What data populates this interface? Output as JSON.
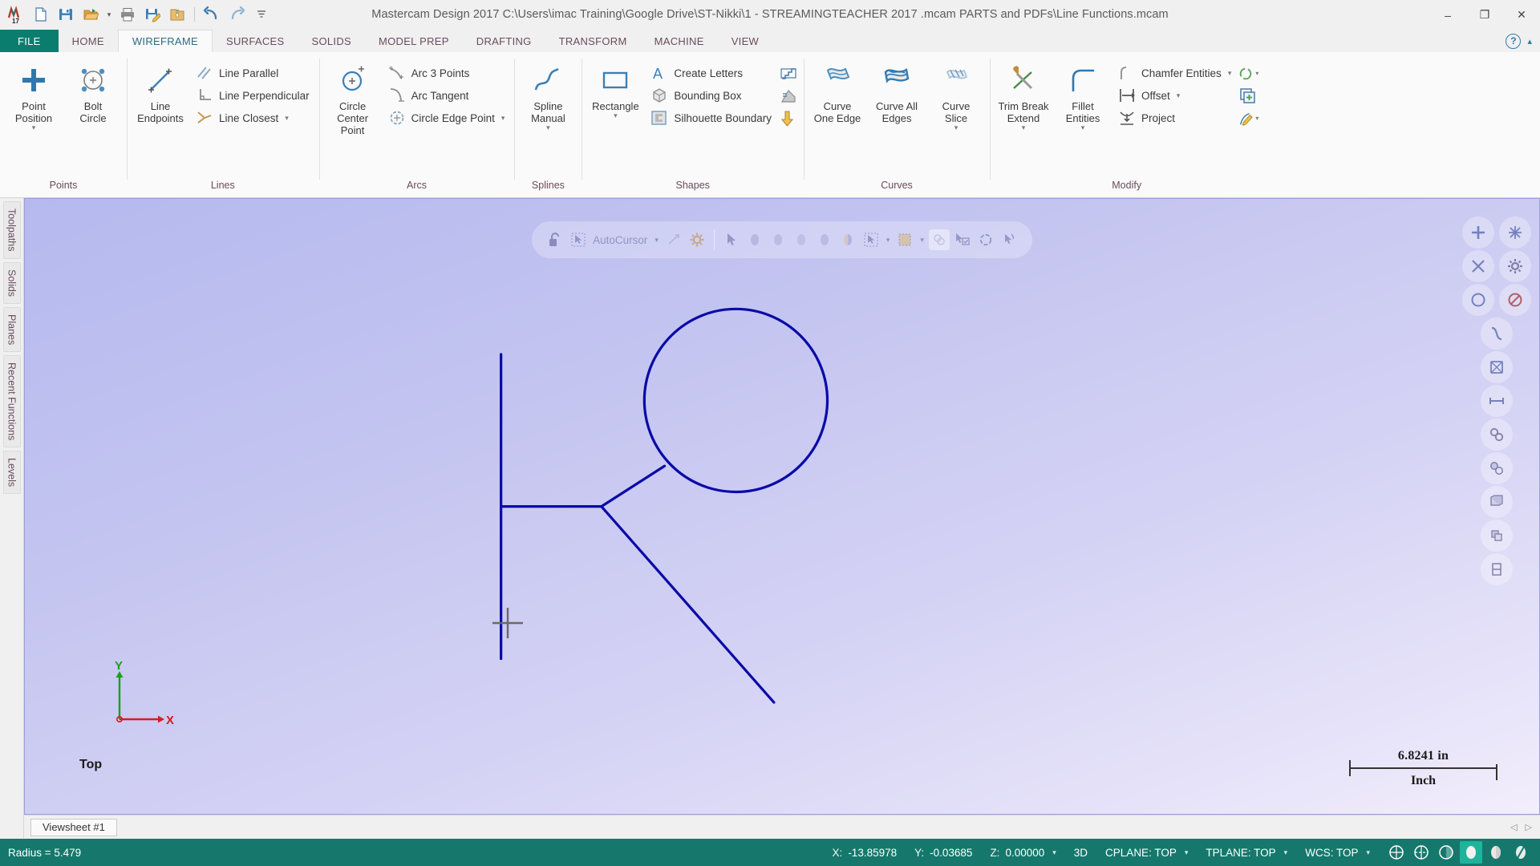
{
  "window": {
    "title": "Mastercam Design 2017  C:\\Users\\imac Training\\Google Drive\\ST-Nikki\\1 - STREAMINGTEACHER 2017 .mcam PARTS and PDFs\\Line Functions.mcam",
    "minimize": "–",
    "restore": "❐",
    "close": "✕"
  },
  "quick_access": [
    {
      "name": "mastercam-logo-icon",
      "label": "M17"
    },
    {
      "name": "new-file-icon",
      "label": "New"
    },
    {
      "name": "save-icon",
      "label": "Save"
    },
    {
      "name": "open-folder-icon",
      "label": "Open"
    },
    {
      "name": "open-dropdown-caret",
      "label": "▾"
    },
    {
      "name": "print-icon",
      "label": "Print"
    },
    {
      "name": "save-as-icon",
      "label": "Save As"
    },
    {
      "name": "zip2go-icon",
      "label": "Zip2Go"
    },
    {
      "name": "undo-icon",
      "label": "Undo"
    },
    {
      "name": "redo-icon",
      "label": "Redo"
    },
    {
      "name": "customize-qat-icon",
      "label": "≡"
    }
  ],
  "tabs": [
    {
      "label": "FILE",
      "kind": "file"
    },
    {
      "label": "HOME",
      "kind": "normal"
    },
    {
      "label": "WIREFRAME",
      "kind": "active"
    },
    {
      "label": "SURFACES",
      "kind": "normal"
    },
    {
      "label": "SOLIDS",
      "kind": "normal"
    },
    {
      "label": "MODEL PREP",
      "kind": "normal"
    },
    {
      "label": "DRAFTING",
      "kind": "normal"
    },
    {
      "label": "TRANSFORM",
      "kind": "normal"
    },
    {
      "label": "MACHINE",
      "kind": "normal"
    },
    {
      "label": "VIEW",
      "kind": "normal"
    }
  ],
  "help": {
    "help_label": "?",
    "collapse_label": "▴"
  },
  "ribbon": {
    "groups": [
      {
        "label": "Points",
        "big": [
          {
            "label": "Point\nPosition",
            "icon": "point-position-icon",
            "dropdown": true
          },
          {
            "label": "Bolt\nCircle",
            "icon": "bolt-circle-icon",
            "dropdown": false
          }
        ],
        "small": []
      },
      {
        "label": "Lines",
        "big": [
          {
            "label": "Line\nEndpoints",
            "icon": "line-endpoints-icon",
            "dropdown": false
          }
        ],
        "small": [
          {
            "label": "Line Parallel",
            "icon": "line-parallel-icon",
            "dropdown": false
          },
          {
            "label": "Line Perpendicular",
            "icon": "line-perpendicular-icon",
            "dropdown": false
          },
          {
            "label": "Line Closest",
            "icon": "line-closest-icon",
            "dropdown": true
          }
        ]
      },
      {
        "label": "Arcs",
        "big": [
          {
            "label": "Circle\nCenter Point",
            "icon": "circle-center-point-icon",
            "dropdown": false
          }
        ],
        "small": [
          {
            "label": "Arc 3 Points",
            "icon": "arc-3-points-icon",
            "dropdown": false
          },
          {
            "label": "Arc Tangent",
            "icon": "arc-tangent-icon",
            "dropdown": false
          },
          {
            "label": "Circle Edge Point",
            "icon": "circle-edge-point-icon",
            "dropdown": true
          }
        ]
      },
      {
        "label": "Splines",
        "big": [
          {
            "label": "Spline\nManual",
            "icon": "spline-manual-icon",
            "dropdown": true
          }
        ],
        "small": []
      },
      {
        "label": "Shapes",
        "big": [
          {
            "label": "Rectangle",
            "icon": "rectangle-icon",
            "dropdown": true
          }
        ],
        "small": [
          {
            "label": "Create Letters",
            "icon": "create-letters-icon",
            "dropdown": false
          },
          {
            "label": "Bounding Box",
            "icon": "bounding-box-icon",
            "dropdown": false
          },
          {
            "label": "Silhouette Boundary",
            "icon": "silhouette-boundary-icon",
            "dropdown": false
          }
        ],
        "icons": [
          {
            "name": "stairs-icon"
          },
          {
            "name": "relief-groove-icon"
          },
          {
            "name": "door-icon"
          }
        ]
      },
      {
        "label": "Curves",
        "big": [
          {
            "label": "Curve\nOne Edge",
            "icon": "curve-one-edge-icon",
            "dropdown": false
          },
          {
            "label": "Curve All\nEdges",
            "icon": "curve-all-edges-icon",
            "dropdown": false
          },
          {
            "label": "Curve\nSlice",
            "icon": "curve-slice-icon",
            "dropdown": true
          }
        ],
        "small": []
      },
      {
        "label": "Modify",
        "big": [
          {
            "label": "Trim Break\nExtend",
            "icon": "trim-break-extend-icon",
            "dropdown": true
          },
          {
            "label": "Fillet\nEntities",
            "icon": "fillet-entities-icon",
            "dropdown": true
          }
        ],
        "small": [
          {
            "label": "Chamfer Entities",
            "icon": "chamfer-entities-icon",
            "dropdown": true
          },
          {
            "label": "Offset",
            "icon": "offset-icon",
            "dropdown": true
          },
          {
            "label": "Project",
            "icon": "project-icon",
            "dropdown": false
          }
        ],
        "icons": [
          {
            "name": "modify-closed-loop-icon",
            "dropdown": true
          },
          {
            "name": "offset-contour-icon",
            "dropdown": false
          },
          {
            "name": "modify-spline-icon",
            "dropdown": true
          }
        ]
      }
    ]
  },
  "left_rail": [
    {
      "label": "Toolpaths"
    },
    {
      "label": "Solids"
    },
    {
      "label": "Planes"
    },
    {
      "label": "Recent Functions"
    },
    {
      "label": "Levels"
    }
  ],
  "autocursor": {
    "lock_icon": "unlock-icon",
    "label": "AutoCursor",
    "caret": "▾",
    "settings_icon": "autocursor-settings-icon",
    "snap_icon": "autocursor-snap-icon",
    "selection_icons": [
      "select-arrow-icon",
      "select-wireframe-icon",
      "select-face-icon",
      "select-solid-icon",
      "select-body-icon",
      "select-partial-icon"
    ],
    "verify_icons": [
      "select-all-icon",
      "select-only-icon",
      "select-window-icon"
    ],
    "analyze_icons": [
      "analyze-icon",
      "analyze-toggle-icon",
      "analyze-dynamic-icon",
      "analyze-pick-icon"
    ]
  },
  "right_rail": [
    "fit-view-icon",
    "repaint-icon",
    "zoom-window-icon",
    "view-settings-icon",
    "unzoom-icon",
    "no-shade-icon",
    "dynamic-rotate-icon",
    "wireframe-view-icon",
    "fit-screen-icon",
    "shaded-view-icon",
    "shaded-wire-icon",
    "translucent-icon",
    "material-icon",
    "section-icon",
    "isometric-icon"
  ],
  "viewport": {
    "view_label": "Top",
    "axis_x": "X",
    "axis_y": "Y",
    "scale_value": "6.8241 in",
    "scale_unit": "Inch",
    "geometry_color": "#0a0aa8"
  },
  "viewsheet": {
    "tab_label": "Viewsheet #1",
    "nav_prev": "◁",
    "nav_next": "▷"
  },
  "statusbar": {
    "message": "Radius = 5.479",
    "coords": [
      {
        "key": "X:",
        "value": "-13.85978",
        "caret": false
      },
      {
        "key": "Y:",
        "value": "-0.03685",
        "caret": false
      },
      {
        "key": "Z:",
        "value": "0.00000",
        "caret": true
      }
    ],
    "mode": "3D",
    "planes": [
      {
        "label": "CPLANE: TOP",
        "caret": true
      },
      {
        "label": "TPLANE: TOP",
        "caret": true
      },
      {
        "label": "WCS: TOP",
        "caret": true
      }
    ],
    "icons": [
      {
        "name": "wireframe-shading-icon",
        "selected": false
      },
      {
        "name": "hidden-lines-icon",
        "selected": false
      },
      {
        "name": "shaded-hidden-icon",
        "selected": false
      },
      {
        "name": "shaded-solid-icon",
        "selected": true
      },
      {
        "name": "shaded-translucent-icon",
        "selected": false
      },
      {
        "name": "shaded-material-icon",
        "selected": false
      }
    ],
    "accent": "#16786c"
  }
}
